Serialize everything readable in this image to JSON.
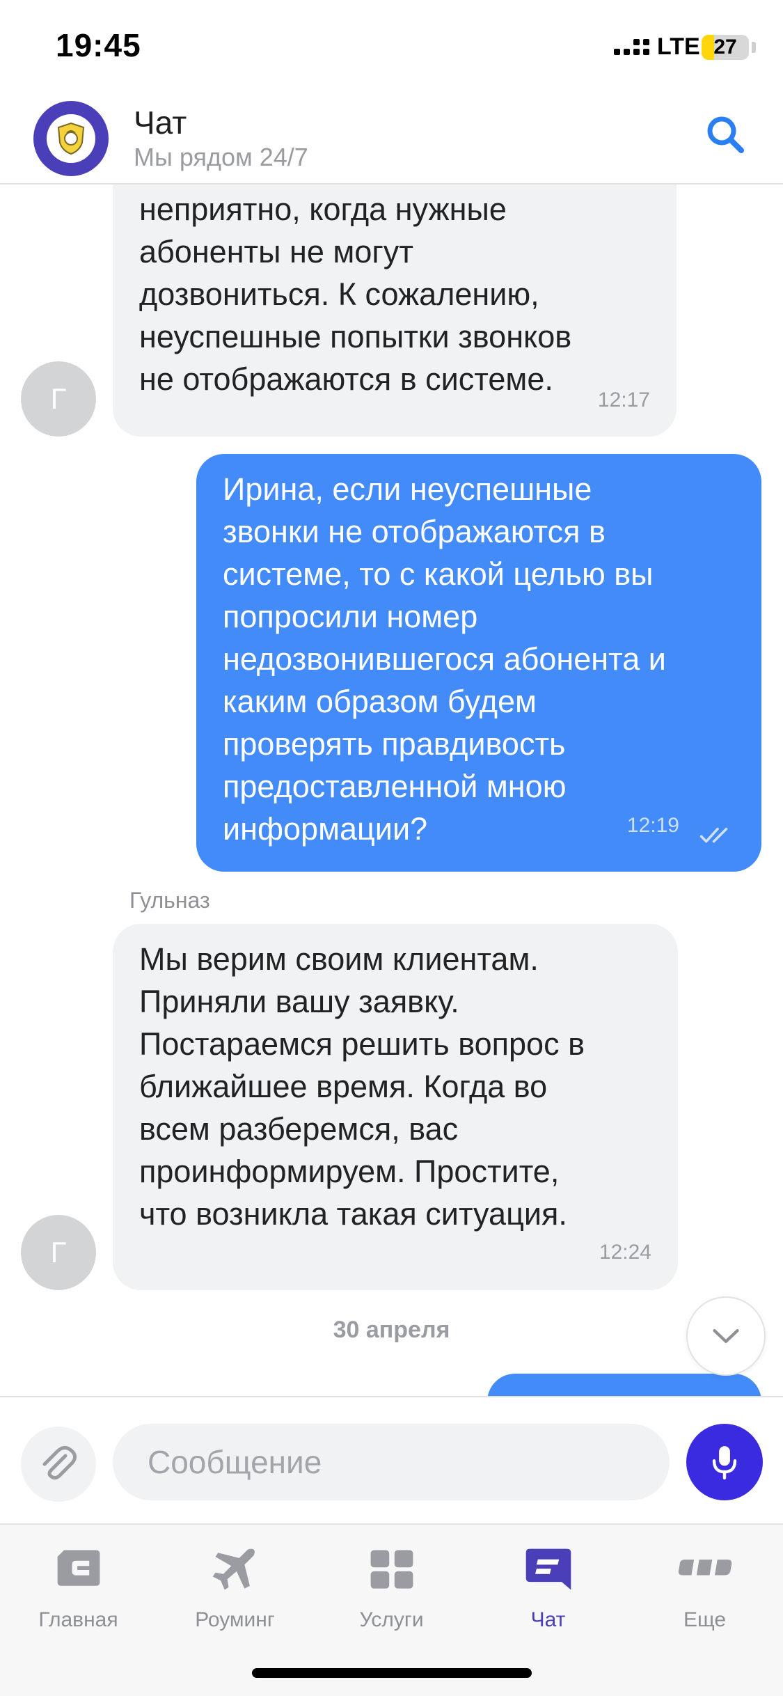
{
  "status_bar": {
    "time": "19:45",
    "network": "LTE",
    "battery": "27",
    "battery_level": 0.27
  },
  "header": {
    "title": "Чат",
    "subtitle": "Мы рядом 24/7"
  },
  "messages": [
    {
      "direction": "in",
      "text": "неприятно, когда нужные\nабоненты не могут\nдозвониться. К сожалению,\nнеуспешные попытки звонков\nне отображаются в системе.",
      "time": "12:17",
      "avatar": "Г"
    },
    {
      "direction": "out",
      "text": "Ирина, если неуспешные\nзвонки не отображаются в\nсистеме, то с какой целью вы\nпопросили номер\nнедозвонившегося абонента и\nкаким образом будем\nпроверять правдивость\nпредоставленной мною\nинформации?",
      "time": "12:19",
      "status": "read"
    },
    {
      "direction": "in",
      "sender": "Гульназ",
      "text": "Мы верим своим клиентам.\nПриняли вашу заявку.\nПостараемся решить вопрос в\nближайшее время. Когда во\nвсем разберемся, вас\nпроинформируем. Простите,\nчто возникла такая ситуация.",
      "time": "12:24",
      "avatar": "Г"
    }
  ],
  "date_separator": "30 апреля",
  "input": {
    "placeholder": "Сообщение"
  },
  "tabs": [
    {
      "label": "Главная",
      "icon": "home-card-icon",
      "active": false
    },
    {
      "label": "Роуминг",
      "icon": "airplane-icon",
      "active": false
    },
    {
      "label": "Услуги",
      "icon": "grid-icon",
      "active": false
    },
    {
      "label": "Чат",
      "icon": "chat-icon",
      "active": true
    },
    {
      "label": "Еще",
      "icon": "more-icon",
      "active": false
    }
  ],
  "colors": {
    "accent": "#4b3fb9",
    "outgoing_bubble": "#428bf9",
    "incoming_bubble": "#f1f2f4",
    "link": "#2a7ff3",
    "mic": "#3b2be0"
  }
}
